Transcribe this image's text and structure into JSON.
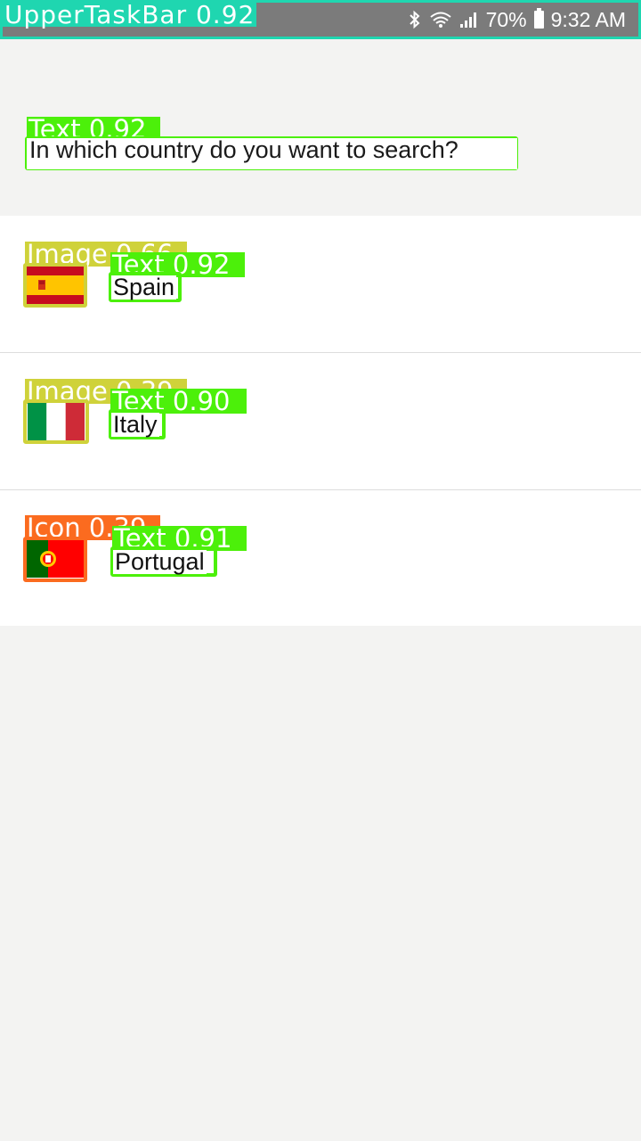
{
  "status_bar": {
    "detection_label": "UpperTaskBar 0.92",
    "battery_percent": "70%",
    "time": "9:32 AM",
    "icons": [
      "bluetooth-icon",
      "wifi-icon",
      "signal-icon",
      "battery-icon"
    ]
  },
  "prompt": {
    "question": "In which country do you want to search?",
    "detection_label": "Text 0.92"
  },
  "countries": [
    {
      "name": "Spain",
      "flag_icon": "spain-flag-icon",
      "image_label": "Image 0.66",
      "text_label": "Text 0.92"
    },
    {
      "name": "Italy",
      "flag_icon": "italy-flag-icon",
      "image_label": "Image 0.39",
      "text_label": "Text 0.90"
    },
    {
      "name": "Portugal",
      "flag_icon": "portugal-flag-icon",
      "image_label": "Icon 0.39",
      "text_label": "Text 0.91"
    }
  ],
  "colors": {
    "text_box": "#4cf00a",
    "image_box": "#cfd23a",
    "icon_box": "#fb6b1f",
    "taskbar_box": "#1fd6b0",
    "background": "#f3f3f2"
  }
}
